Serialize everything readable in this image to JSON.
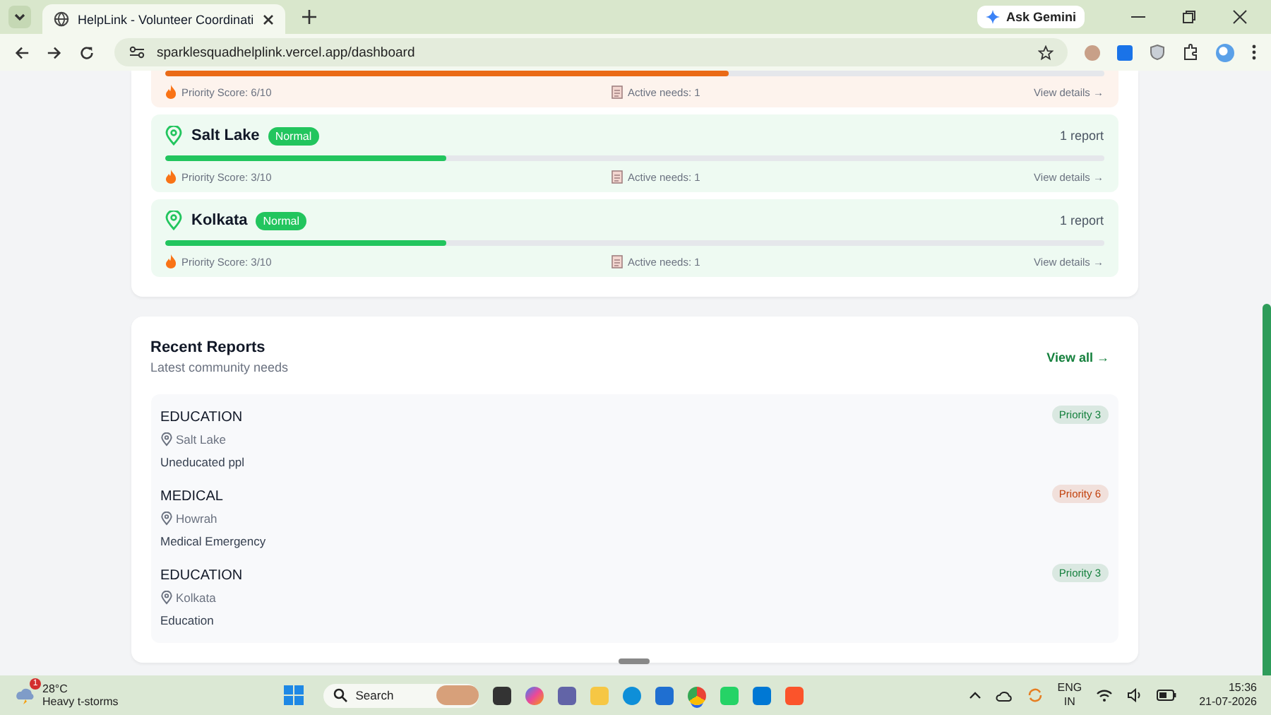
{
  "browser": {
    "tab_title": "HelpLink - Volunteer Coordinati",
    "ask_gemini": "Ask Gemini",
    "url": "sparklesquadhelplink.vercel.app/dashboard"
  },
  "areas": [
    {
      "color": "#ea6a16",
      "level": 0.6,
      "priority_score": "Priority Score: 6/10",
      "active_needs": "Active needs: 1",
      "view_details": "View details →"
    },
    {
      "color": "#22c55e",
      "name": "Salt Lake",
      "badge": "Normal",
      "reports": "1 report",
      "level": 0.3,
      "priority_score": "Priority Score: 3/10",
      "active_needs": "Active needs: 1",
      "view_details": "View details →"
    },
    {
      "color": "#22c55e",
      "name": "Kolkata",
      "badge": "Normal",
      "reports": "1 report",
      "level": 0.3,
      "priority_score": "Priority Score: 3/10",
      "active_needs": "Active needs: 1",
      "view_details": "View details →"
    }
  ],
  "recent_reports": {
    "title": "Recent Reports",
    "subtitle": "Latest community needs",
    "view_all": "View all →",
    "items": [
      {
        "category": "EDUCATION",
        "location": "Salt Lake",
        "description": "Uneducated ppl",
        "priority": "Priority 3",
        "color": "#15803d"
      },
      {
        "category": "MEDICAL",
        "location": "Howrah",
        "description": "Medical Emergency",
        "priority": "Priority 6",
        "color": "#c2410c"
      },
      {
        "category": "EDUCATION",
        "location": "Kolkata",
        "description": "Education",
        "priority": "Priority 3",
        "color": "#15803d"
      }
    ]
  },
  "taskbar": {
    "weather_temp": "28°C",
    "weather_desc": "Heavy t-storms",
    "weather_badge": "1",
    "search": "Search",
    "language": "ENG",
    "region": "IN",
    "time": "15:36",
    "date": "21-07-2026"
  }
}
